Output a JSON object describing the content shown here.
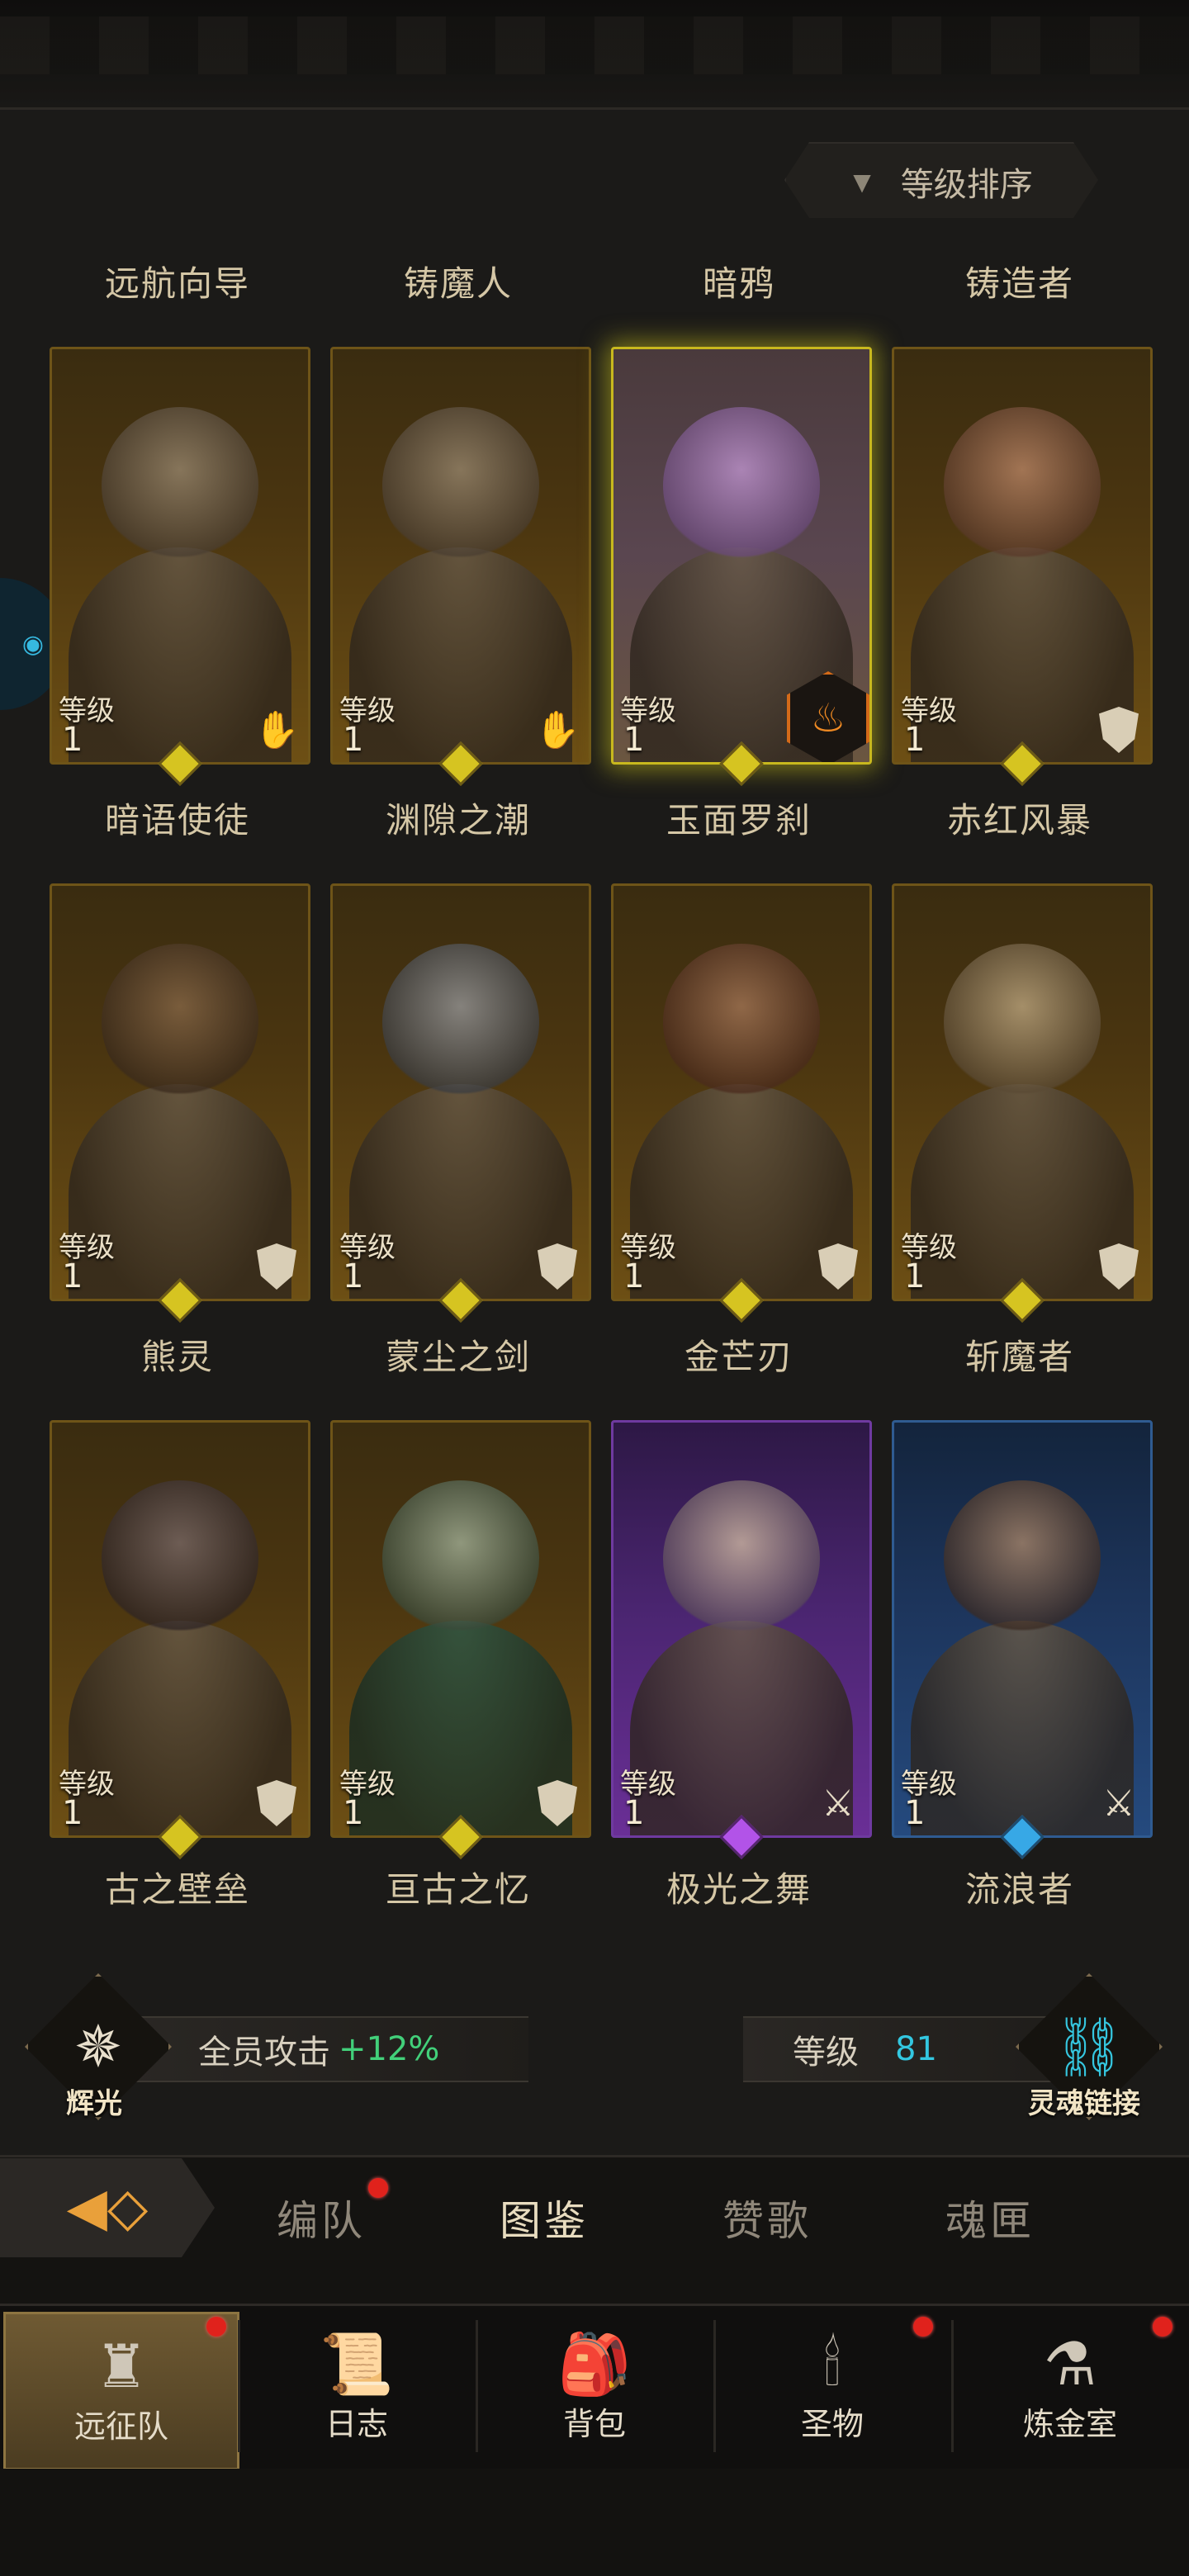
{
  "sort_label": "等级排序",
  "level_label": "等级",
  "heroes": [
    {
      "name": "远航向导",
      "level": "1",
      "rarity": "gold",
      "class_icon": "hand-icon"
    },
    {
      "name": "铸魔人",
      "level": "1",
      "rarity": "gold",
      "class_icon": "hand-icon"
    },
    {
      "name": "暗鸦",
      "level": "1",
      "rarity": "gold",
      "class_icon": "flame-badge-icon",
      "highlight": true
    },
    {
      "name": "铸造者",
      "level": "1",
      "rarity": "gold",
      "class_icon": "shield-icon"
    },
    {
      "name": "暗语使徒",
      "level": "1",
      "rarity": "gold",
      "class_icon": "shield-icon"
    },
    {
      "name": "渊隙之潮",
      "level": "1",
      "rarity": "gold",
      "class_icon": "shield-icon"
    },
    {
      "name": "玉面罗刹",
      "level": "1",
      "rarity": "gold",
      "class_icon": "shield-icon"
    },
    {
      "name": "赤红风暴",
      "level": "1",
      "rarity": "gold",
      "class_icon": "shield-icon"
    },
    {
      "name": "熊灵",
      "level": "1",
      "rarity": "gold",
      "class_icon": "shield-icon"
    },
    {
      "name": "蒙尘之剑",
      "level": "1",
      "rarity": "gold",
      "class_icon": "shield-icon"
    },
    {
      "name": "金芒刃",
      "level": "1",
      "rarity": "purple",
      "class_icon": "sword-icon"
    },
    {
      "name": "斩魔者",
      "level": "1",
      "rarity": "blue",
      "class_icon": "sword-icon"
    }
  ],
  "bottom_names": [
    "古之壁垒",
    "亘古之忆",
    "极光之舞",
    "流浪者"
  ],
  "stats": {
    "left_caption": "辉光",
    "attack_label": "全员攻击",
    "attack_value": "+12%",
    "level_label": "等级",
    "level_value": "81",
    "right_caption": "灵魂链接"
  },
  "tabs": [
    "编队",
    "图鉴",
    "赞歌",
    "魂匣"
  ],
  "active_tab": "图鉴",
  "nav": [
    "远征队",
    "日志",
    "背包",
    "圣物",
    "炼金室"
  ],
  "colors": {
    "accent_gold": "#c8a23a",
    "green": "#42d07a",
    "cyan": "#33c7e0",
    "red_dot": "#e0221c"
  }
}
